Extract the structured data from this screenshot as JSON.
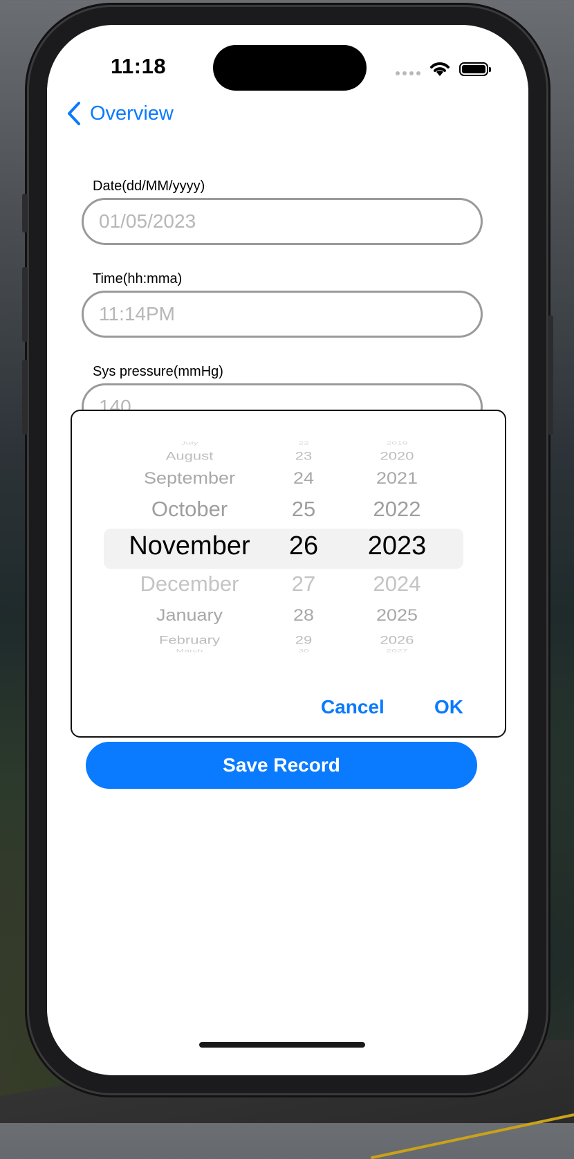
{
  "status_bar": {
    "time": "11:18"
  },
  "nav": {
    "back_label": "Overview"
  },
  "form": {
    "date": {
      "label": "Date(dd/MM/yyyy)",
      "placeholder": "01/05/2023"
    },
    "time": {
      "label": "Time(hh:mma)",
      "placeholder": "11:14PM"
    },
    "sys": {
      "label": "Sys pressure(mmHg)",
      "placeholder": "140"
    }
  },
  "picker": {
    "months": [
      "July",
      "August",
      "September",
      "October",
      "November",
      "December",
      "January",
      "February",
      "March"
    ],
    "days": [
      "22",
      "23",
      "24",
      "25",
      "26",
      "27",
      "28",
      "29",
      "30"
    ],
    "years": [
      "2019",
      "2020",
      "2021",
      "2022",
      "2023",
      "2024",
      "2025",
      "2026",
      "2027"
    ],
    "selected": {
      "month": "November",
      "day": "26",
      "year": "2023"
    }
  },
  "dialog": {
    "cancel_label": "Cancel",
    "ok_label": "OK"
  },
  "save_button": {
    "label": "Save Record"
  },
  "colors": {
    "accent": "#0a7aff",
    "field_border": "#9a9a9a",
    "placeholder": "#b7b7b7"
  }
}
